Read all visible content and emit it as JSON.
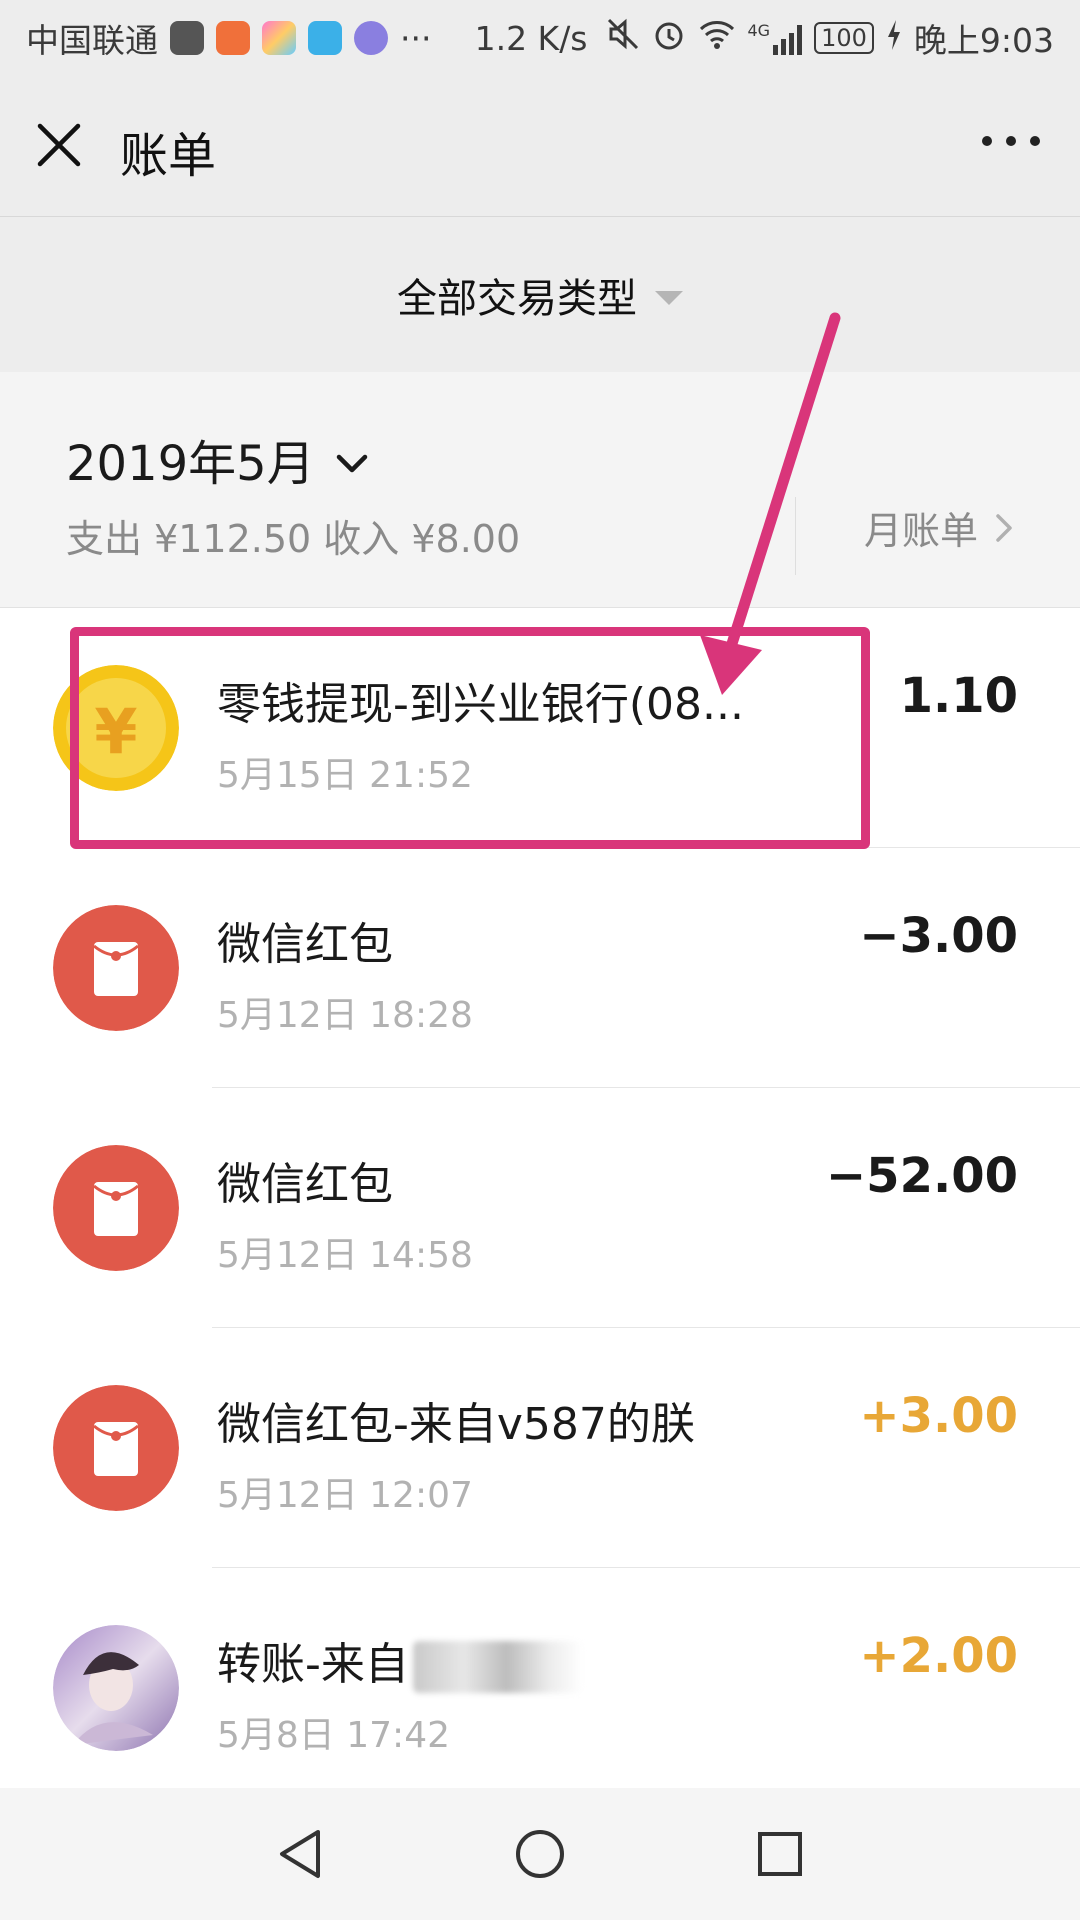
{
  "status_bar": {
    "carrier": "中国联通",
    "speed": "1.2 K/s",
    "signal_tag": "4G",
    "battery": "100",
    "time": "晚上9:03",
    "overflow": "···"
  },
  "nav": {
    "title": "账单",
    "close_icon": "close-icon",
    "more_icon": "more-icon"
  },
  "filter": {
    "label": "全部交易类型"
  },
  "summary": {
    "month": "2019年5月",
    "totals": "支出 ¥112.50 收入 ¥8.00",
    "monthly_bill": "月账单"
  },
  "transactions": [
    {
      "title": "零钱提现-到兴业银行(08...",
      "time": "5月15日 21:52",
      "amount": "1.10",
      "type": "withdraw",
      "icon": "yuan-coin-icon"
    },
    {
      "title": "微信红包",
      "time": "5月12日 18:28",
      "amount": "−3.00",
      "type": "expense",
      "icon": "red-packet-icon"
    },
    {
      "title": "微信红包",
      "time": "5月12日 14:58",
      "amount": "−52.00",
      "type": "expense",
      "icon": "red-packet-icon"
    },
    {
      "title": "微信红包-来自v587的朕",
      "time": "5月12日 12:07",
      "amount": "+3.00",
      "type": "income",
      "icon": "red-packet-icon"
    },
    {
      "title": "转账-来自",
      "time": "5月8日 17:42",
      "amount": "+2.00",
      "type": "income",
      "icon": "user-avatar"
    }
  ],
  "colors": {
    "annotation": "#d9357a",
    "income": "#e8a736",
    "red_packet": "#e0594a",
    "coin": "#f5c518"
  }
}
